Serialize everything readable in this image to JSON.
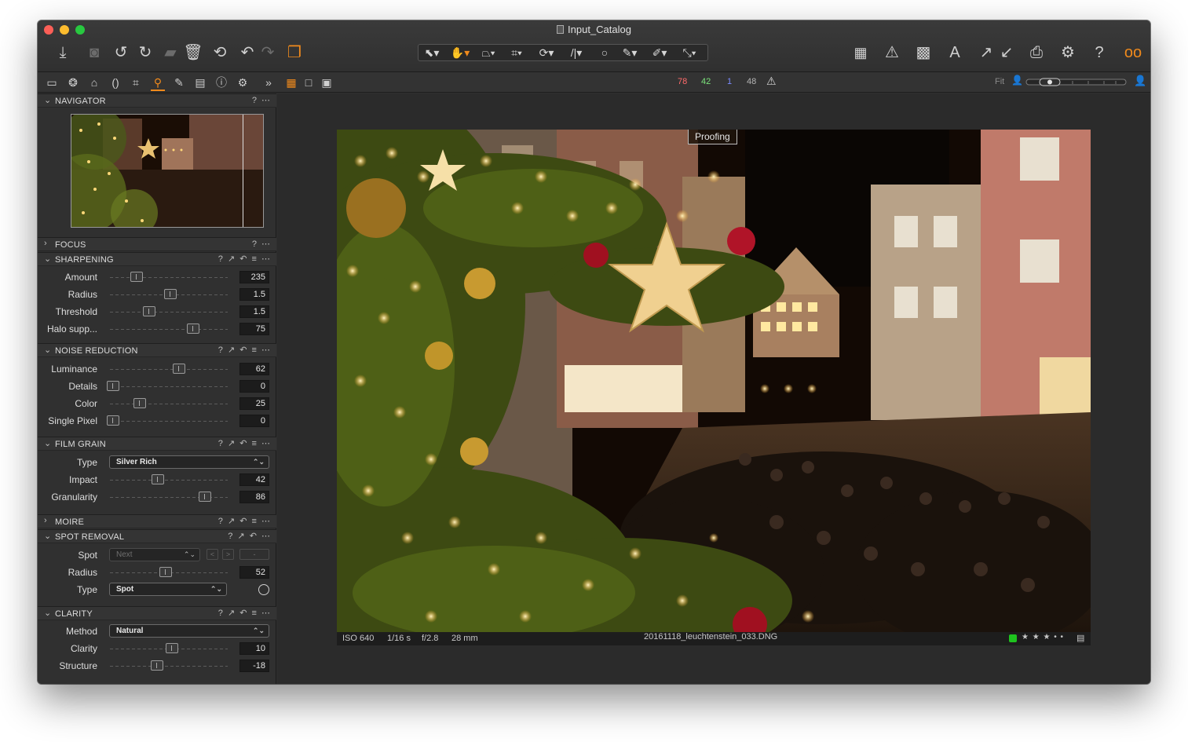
{
  "window": {
    "title": "Input_Catalog"
  },
  "toolbar": {
    "icons": [
      "import-icon",
      "camera-icon",
      "rotate-left-icon",
      "rotate-right-icon",
      "move-to-icon",
      "trash-icon",
      "undo-icon",
      "undo-step-icon",
      "redo-icon",
      "variants-icon"
    ],
    "cursor_tools": [
      "select-cursor",
      "pan-hand",
      "keystone",
      "crop",
      "rotate",
      "straighten",
      "circle-mask",
      "brush",
      "eraser-pen",
      "picker"
    ],
    "right_icons": [
      "grid-layout-icon",
      "warning-icon",
      "focus-mask-icon",
      "text-overlay-icon",
      "export-icon",
      "import-arrow-icon",
      "print-icon",
      "settings-icon",
      "help-icon",
      "proof-glasses-icon"
    ]
  },
  "subbar": {
    "counts": [
      {
        "value": "78",
        "color": "#ff6b6b"
      },
      {
        "value": "42",
        "color": "#7be37b"
      },
      {
        "value": "1",
        "color": "#7b8bff"
      },
      {
        "value": "48",
        "color": "#b5b5b5"
      }
    ],
    "fit_label": "Fit"
  },
  "sections": {
    "navigator": {
      "title": "NAVIGATOR",
      "icons": "? ⋯"
    },
    "focus": {
      "title": "FOCUS",
      "icons": "? ⋯"
    },
    "sharpening": {
      "title": "SHARPENING",
      "icons": "? ↗ ↶ ≡ ⋯",
      "rows": [
        {
          "label": "Amount",
          "value": "235",
          "pos": 0.22
        },
        {
          "label": "Radius",
          "value": "1.5",
          "pos": 0.54
        },
        {
          "label": "Threshold",
          "value": "1.5",
          "pos": 0.34
        },
        {
          "label": "Halo supp...",
          "value": "75",
          "pos": 0.75
        }
      ]
    },
    "noise": {
      "title": "NOISE REDUCTION",
      "icons": "? ↗ ↶ ≡ ⋯",
      "rows": [
        {
          "label": "Luminance",
          "value": "62",
          "pos": 0.62
        },
        {
          "label": "Details",
          "value": "0",
          "pos": 0.0
        },
        {
          "label": "Color",
          "value": "25",
          "pos": 0.25
        },
        {
          "label": "Single Pixel",
          "value": "0",
          "pos": 0.0
        }
      ]
    },
    "grain": {
      "title": "FILM GRAIN",
      "icons": "? ↗ ↶ ≡ ⋯",
      "type_label": "Type",
      "type_value": "Silver Rich",
      "rows": [
        {
          "label": "Impact",
          "value": "42",
          "pos": 0.42
        },
        {
          "label": "Granularity",
          "value": "86",
          "pos": 0.86
        }
      ]
    },
    "moire": {
      "title": "MOIRE",
      "icons": "? ↗ ↶ ≡ ⋯"
    },
    "spot": {
      "title": "SPOT REMOVAL",
      "icons": "? ↗ ↶ ⋯",
      "spot_label": "Spot",
      "spot_value": "Next",
      "spot_dash": "-",
      "radius_label": "Radius",
      "radius_value": "52",
      "radius_pos": 0.49,
      "type_label": "Type",
      "type_value": "Spot"
    },
    "clarity": {
      "title": "CLARITY",
      "icons": "? ↗ ↶ ≡ ⋯",
      "method_label": "Method",
      "method_value": "Natural",
      "rows": [
        {
          "label": "Clarity",
          "value": "10",
          "pos": 0.55
        },
        {
          "label": "Structure",
          "value": "-18",
          "pos": 0.41
        }
      ]
    }
  },
  "viewer": {
    "proofing_label": "Proofing",
    "iso": "ISO 640",
    "shutter": "1/16 s",
    "aperture": "f/2.8",
    "focal": "28 mm",
    "filename": "20161118_leuchtenstein_033.DNG",
    "rating": "★ ★ ★ • •",
    "color_tag": "#1ec31e"
  }
}
